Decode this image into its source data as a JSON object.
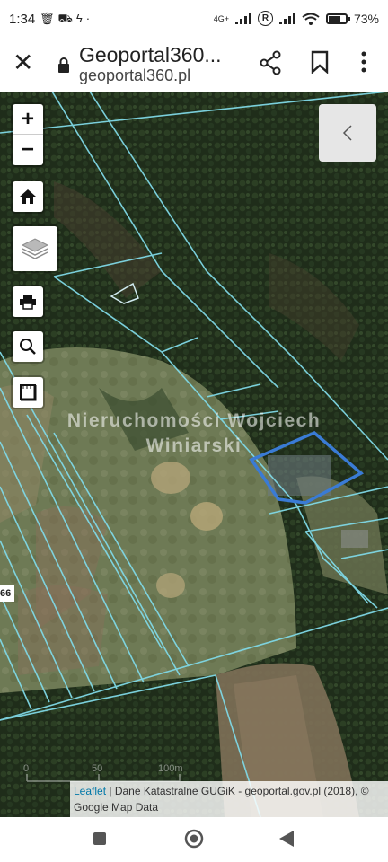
{
  "statusbar": {
    "time": "1:34",
    "left_icons": [
      "trash-icon",
      "car-icon",
      "bolt-icon",
      "dot-icon"
    ],
    "network": "4G+",
    "registered": "R",
    "battery_percent": "73%",
    "battery_level": 0.73
  },
  "toolbar": {
    "title": "Geoportal360...",
    "url": "geoportal360.pl"
  },
  "map": {
    "zoom_in": "+",
    "zoom_out": "−",
    "watermark_line1": "Nieruchomości Wojciech",
    "watermark_line2": "Winiarski",
    "edge_label": "66",
    "scale_labels": [
      "0",
      "50",
      "100m"
    ],
    "attribution_link": "Leaflet",
    "attribution_text": " | Dane Katastralne GUGiK - geoportal.gov.pl (2018), © Google Map Data",
    "parcel_line_color": "#7fd8e6",
    "highlight_color": "#3a7bd5"
  }
}
